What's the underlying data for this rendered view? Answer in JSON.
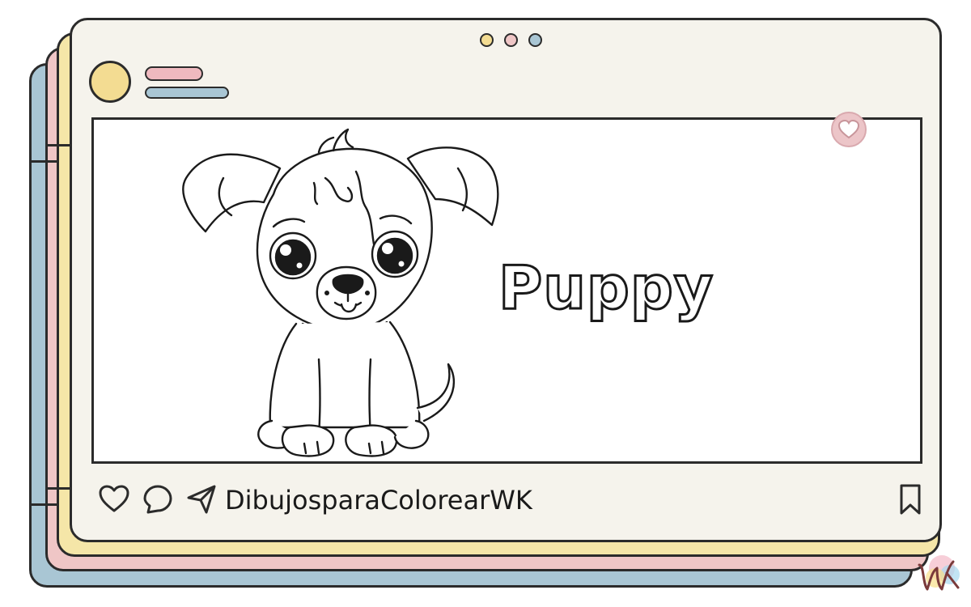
{
  "post": {
    "image_title": "Puppy",
    "account_name": "DibujosparaColorearWK"
  },
  "window_dots": [
    "#f3dc92",
    "#efc6c6",
    "#a9c6d4"
  ],
  "colors": {
    "stack_blue": "#a9c6d4",
    "stack_pink": "#efc6c6",
    "stack_yellow": "#f5e6a8",
    "card_bg": "#f5f3ec",
    "avatar": "#f3dc92",
    "like_badge": "#ecc5c8"
  },
  "icons": {
    "like": "heart-icon",
    "comment": "speech-bubble-icon",
    "share": "paper-plane-icon",
    "save": "bookmark-icon",
    "badge": "heart-badge-icon"
  },
  "logo_text": "WK"
}
